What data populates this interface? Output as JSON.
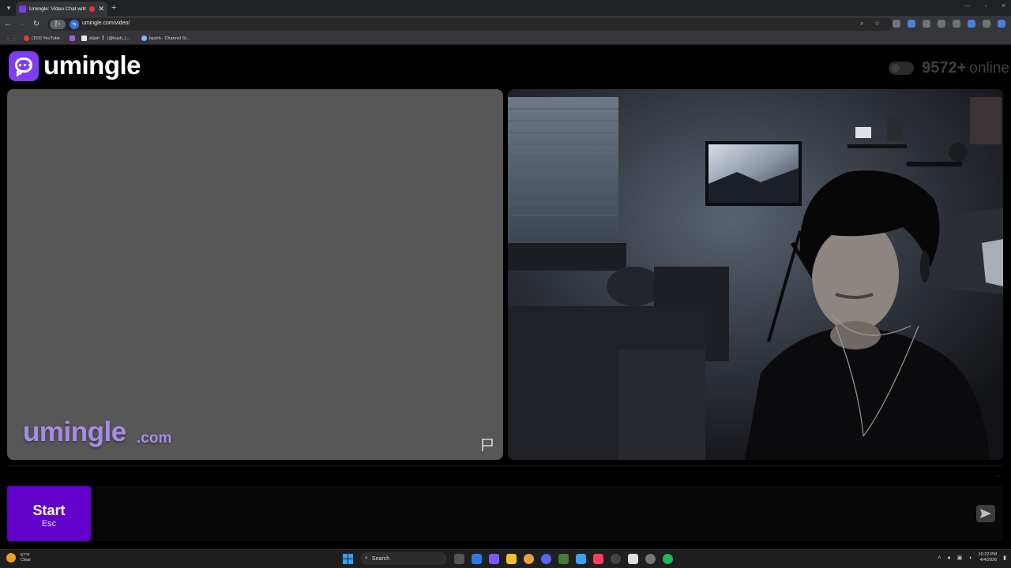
{
  "browser": {
    "tab_title": "Umingle: Video Chat with S",
    "url": "umingle.com/video/",
    "site_chip": "ᥫ᭡",
    "bookmarks": [
      {
        "label": "(153) YouTube",
        "color": "#e53935"
      },
      {
        "label": "",
        "color": "#9b5de5"
      },
      {
        "label": "elijah ❕ (@lejuh_)...",
        "color": "#e8eaed"
      },
      {
        "label": "lejuhh - Channel St...",
        "color": "#8ab4f8"
      }
    ]
  },
  "header": {
    "logo_text": "umingle",
    "online_count": "9572+",
    "online_label": "online"
  },
  "stranger_panel": {
    "watermark_main": "umingle",
    "watermark_domain": ".com",
    "flag_icon": "flag-icon"
  },
  "controls": {
    "start_label": "Start",
    "start_hint": "Esc",
    "chat_placeholder": "",
    "accent_color": "#6100c8"
  },
  "taskbar": {
    "weather_temp": "67°F",
    "weather_desc": "Clear",
    "search_label": "Search",
    "time": "10:22 PM",
    "date": "4/4/2026"
  }
}
